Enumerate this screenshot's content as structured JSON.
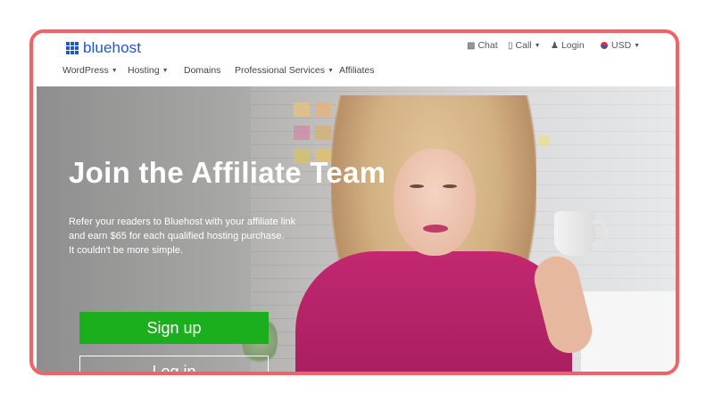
{
  "brand": {
    "name": "bluehost",
    "color": "#1f58c7"
  },
  "utility": {
    "chat": "Chat",
    "call": "Call",
    "login": "Login",
    "currency": "USD"
  },
  "nav": [
    {
      "label": "WordPress",
      "dropdown": true
    },
    {
      "label": "Hosting",
      "dropdown": true
    },
    {
      "label": "Domains",
      "dropdown": false
    },
    {
      "label": "Professional Services",
      "dropdown": true
    },
    {
      "label": "Affiliates",
      "dropdown": false
    }
  ],
  "hero": {
    "title": "Join the Affiliate Team",
    "copy": [
      "Refer your readers to Bluehost with your affiliate link",
      "and earn $65 for each qualified hosting purchase.",
      "It couldn't be more simple."
    ],
    "signup_label": "Sign up",
    "login_label": "Log in"
  },
  "colors": {
    "frame_border": "#f26163",
    "signup_button": "#1bae1d"
  },
  "icons": [
    "chat-icon",
    "phone-icon",
    "user-icon",
    "flag-icon",
    "chevron-down-icon"
  ]
}
